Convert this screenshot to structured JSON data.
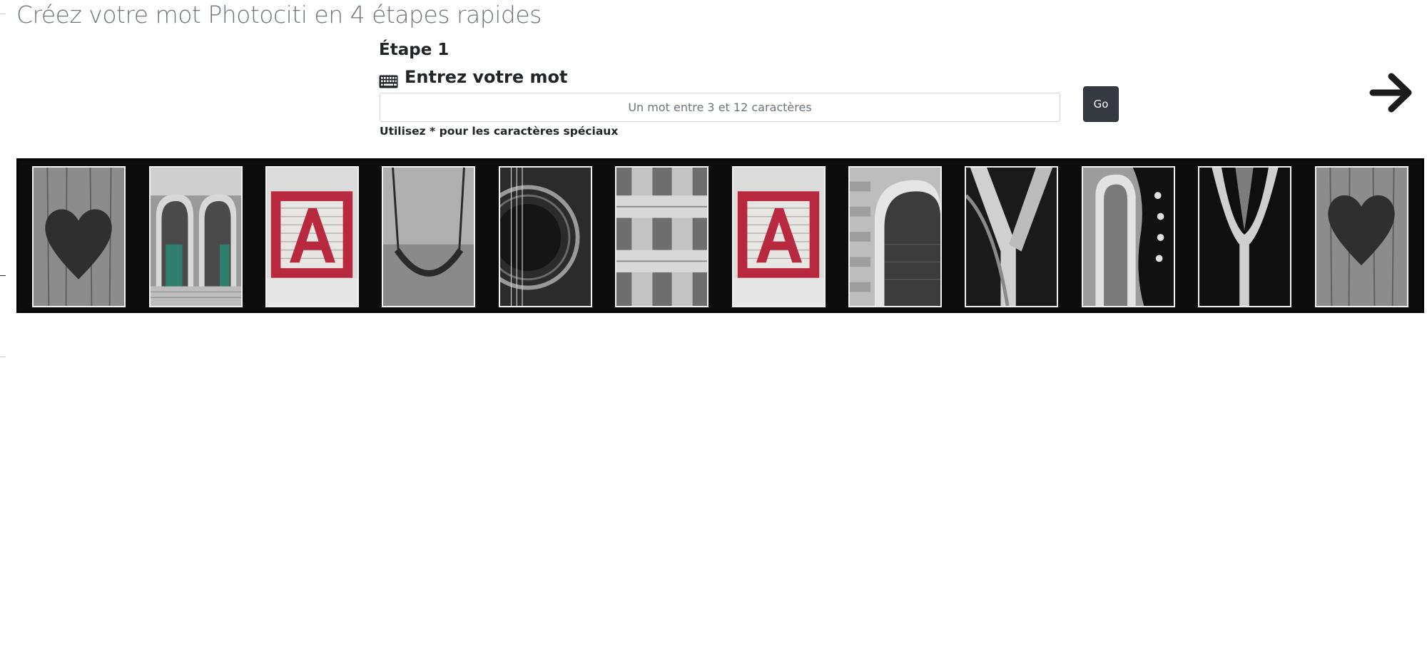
{
  "header": {
    "title": "Créez votre mot Photociti en 4 étapes rapides"
  },
  "step": {
    "number_label": "Étape 1",
    "title": "Entrez votre mot",
    "icon": "keyboard-icon"
  },
  "word_input": {
    "value": "",
    "placeholder": "Un mot entre 3 et 12 caractères"
  },
  "go_button": {
    "label": "Go"
  },
  "hint": {
    "text": "Utilisez * pour les caractères spéciaux"
  },
  "next": {
    "icon": "arrow-right-icon"
  },
  "preview": {
    "letters": [
      {
        "name": "heart-tile",
        "depicts": "heart"
      },
      {
        "name": "arch-doorway-tile",
        "depicts": "arched doorway"
      },
      {
        "name": "letter-block-a-tile",
        "depicts": "A"
      },
      {
        "name": "swing-tile",
        "depicts": "swing"
      },
      {
        "name": "guitar-tile",
        "depicts": "guitar"
      },
      {
        "name": "woven-strap-tile",
        "depicts": "woven strap"
      },
      {
        "name": "letter-block-a-tile-2",
        "depicts": "A"
      },
      {
        "name": "stone-arch-tile",
        "depicts": "stone arch"
      },
      {
        "name": "y-shape-tile",
        "depicts": "Y shape"
      },
      {
        "name": "sneaker-tile",
        "depicts": "sneaker"
      },
      {
        "name": "glass-stem-tile",
        "depicts": "glass stem"
      },
      {
        "name": "heart-tile-2",
        "depicts": "heart"
      }
    ]
  },
  "colors": {
    "title": "#6c757d",
    "text": "#212529",
    "button_bg": "#343a40",
    "strip_bg": "#0c0c0c",
    "block_red": "#b8293f"
  }
}
